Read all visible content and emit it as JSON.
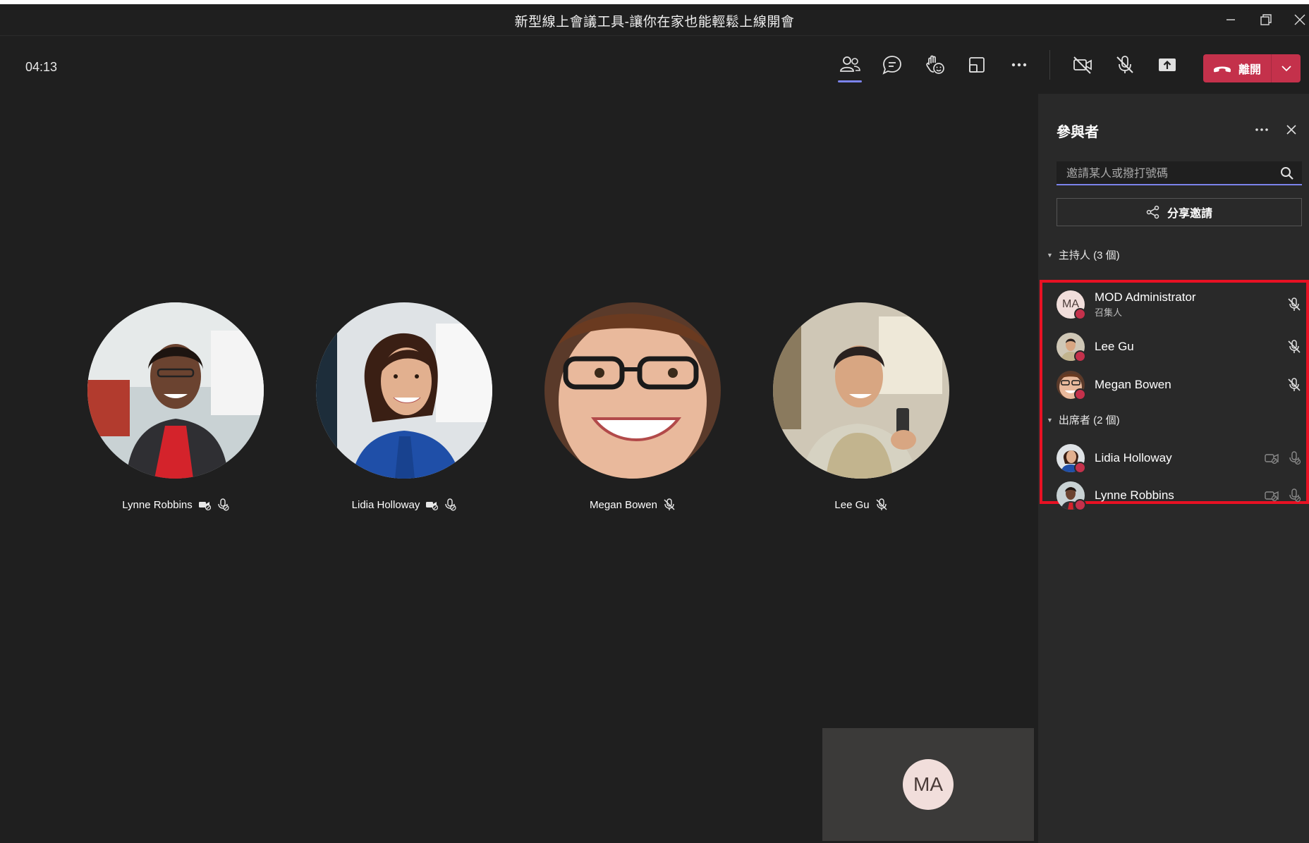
{
  "window": {
    "title": "新型線上會議工具-讓你在家也能輕鬆上線開會"
  },
  "toolbar": {
    "timer": "04:13",
    "leave_label": "離開",
    "icons": [
      "participants-icon",
      "chat-icon",
      "reactions-icon",
      "room-icon",
      "more-icon",
      "camera-off-icon",
      "mic-off-icon",
      "share-screen-icon",
      "phone-hangup-icon",
      "chevron-down-icon"
    ],
    "accent": "#7b83eb",
    "leave_color": "#c4314b"
  },
  "stage": {
    "tiles": [
      {
        "name": "Lynne Robbins",
        "icons": [
          "camera-off-icon",
          "mic-muted-icon"
        ]
      },
      {
        "name": "Lidia Holloway",
        "icons": [
          "camera-off-icon",
          "mic-muted-icon"
        ]
      },
      {
        "name": "Megan Bowen",
        "icons": [
          "mic-off-icon"
        ]
      },
      {
        "name": "Lee Gu",
        "icons": [
          "mic-off-icon"
        ]
      }
    ],
    "self_initials": "MA"
  },
  "panel": {
    "title": "參與者",
    "search_placeholder": "邀請某人或撥打號碼",
    "share_label": "分享邀請",
    "presenters_header": "主持人 (3 個)",
    "attendees_header": "出席者 (2 個)",
    "presenters": [
      {
        "name": "MOD Administrator",
        "role": "召集人",
        "initials": "MA"
      },
      {
        "name": "Lee Gu",
        "role": ""
      },
      {
        "name": "Megan Bowen",
        "role": ""
      }
    ],
    "attendees": [
      {
        "name": "Lidia Holloway"
      },
      {
        "name": "Lynne Robbins"
      }
    ],
    "highlight_color": "#e81123"
  }
}
